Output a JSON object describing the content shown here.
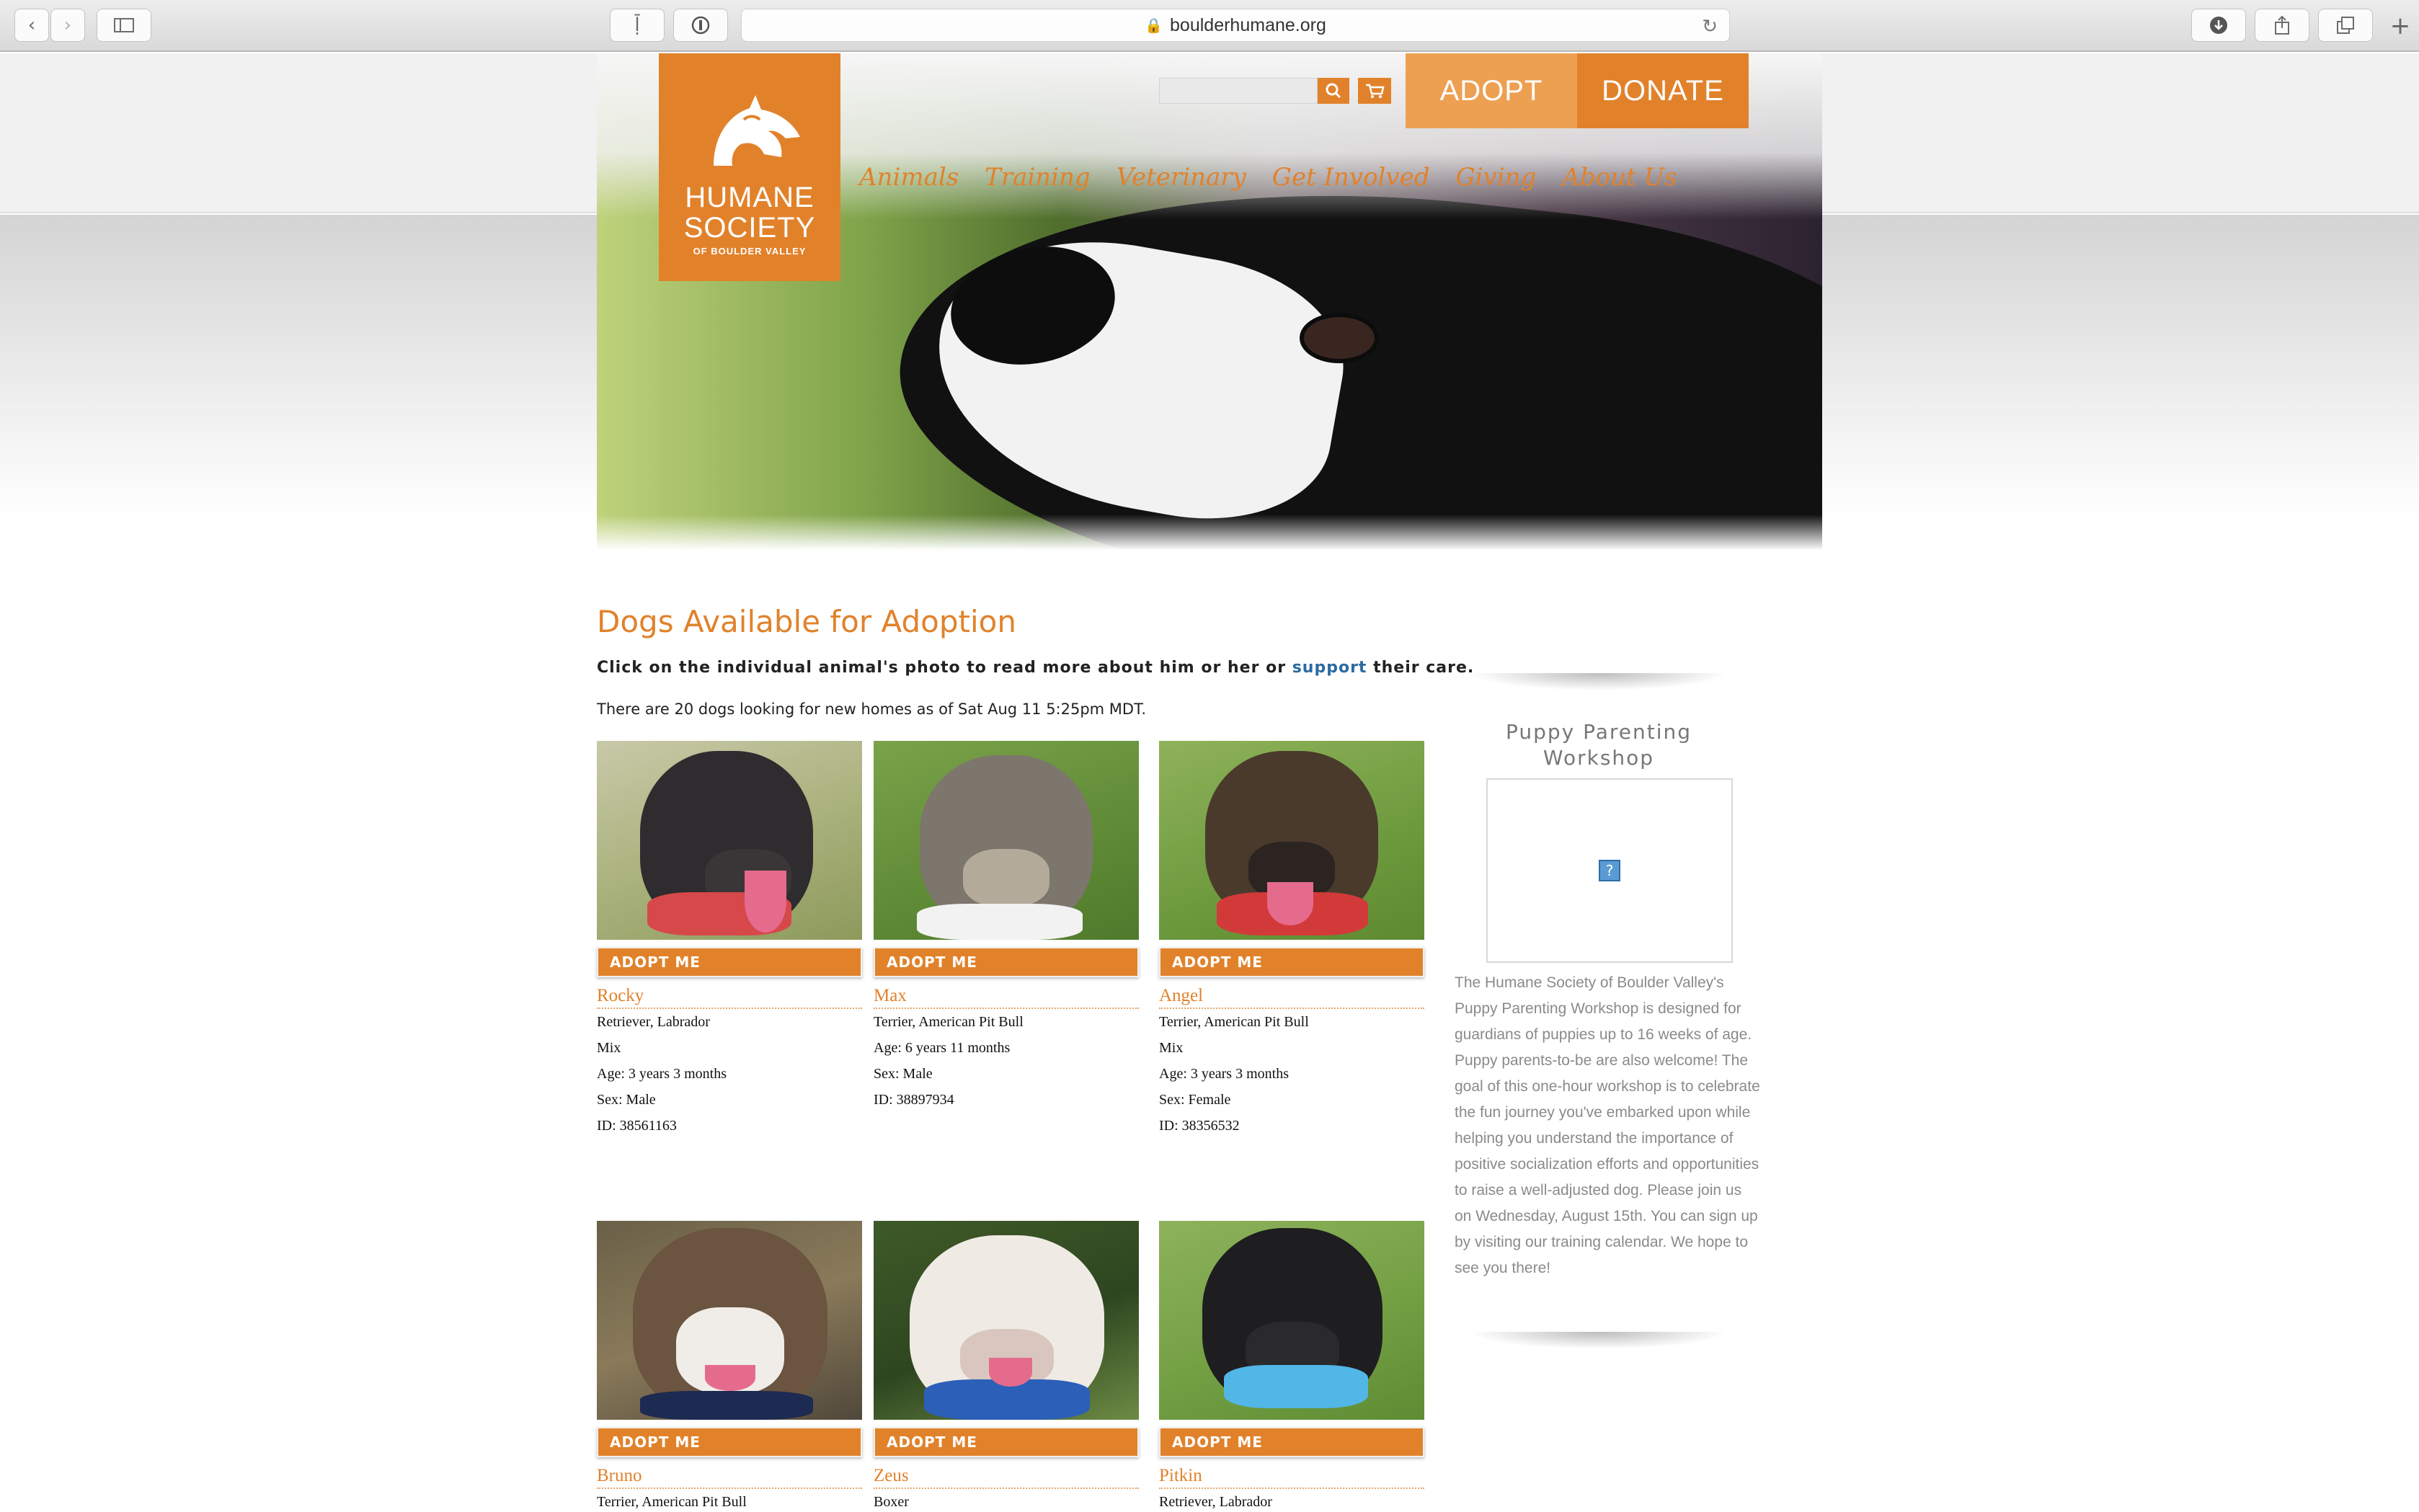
{
  "browser": {
    "url": "boulderhumane.org"
  },
  "site": {
    "logo": {
      "line1": "HUMANE",
      "line2": "SOCIETY",
      "line3": "OF BOULDER VALLEY"
    },
    "adopt_label": "ADOPT",
    "donate_label": "DONATE",
    "nav": [
      "Animals",
      "Training",
      "Veterinary",
      "Get Involved",
      "Giving",
      "About Us"
    ]
  },
  "main": {
    "title": "Dogs Available for Adoption",
    "intro_before": "Click on the individual animal's photo to read more about him or her or ",
    "intro_link": "support",
    "intro_after": " their care.",
    "count_text": "There are 20 dogs looking for new homes as of Sat Aug 11 5:25pm MDT.",
    "adopt_me_label": "ADOPT ME",
    "dogs": [
      {
        "name": "Rocky",
        "breed": "Retriever, Labrador",
        "mix": "Mix",
        "age": "Age: 3 years 3 months",
        "sex": "Sex: Male",
        "id": "ID: 38561163"
      },
      {
        "name": "Max",
        "breed": "Terrier, American Pit Bull",
        "mix": "",
        "age": "Age: 6 years 11 months",
        "sex": "Sex: Male",
        "id": "ID: 38897934"
      },
      {
        "name": "Angel",
        "breed": "Terrier, American Pit Bull",
        "mix": "Mix",
        "age": "Age: 3 years 3 months",
        "sex": "Sex: Female",
        "id": "ID: 38356532"
      },
      {
        "name": "Bruno",
        "breed": "Terrier, American Pit Bull"
      },
      {
        "name": "Zeus",
        "breed": "Boxer"
      },
      {
        "name": "Pitkin",
        "breed": "Retriever, Labrador"
      }
    ]
  },
  "sidebar": {
    "title": "Puppy Parenting Workshop",
    "body": "The Humane Society of Boulder Valley's Puppy Parenting Workshop is designed for guardians of puppies up to 16 weeks of age. Puppy parents-to-be are also welcome! The goal of this one-hour workshop is to celebrate the fun journey you've embarked upon while helping you understand the importance of positive socialization efforts and opportunities to raise a well-adjusted dog. Please join us on Wednesday, August 15th. You can sign up by visiting our training calendar. We hope to see you there!"
  }
}
